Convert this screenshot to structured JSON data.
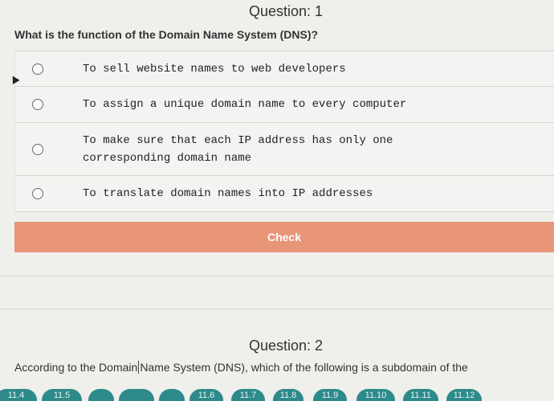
{
  "question1": {
    "header": "Question: 1",
    "prompt": "What is the function of the Domain Name System (DNS)?",
    "choices": [
      {
        "text": "To sell website names to web developers"
      },
      {
        "text": "To assign a unique domain name to every computer"
      },
      {
        "line1": "To make sure that each IP address has only one",
        "line2": "corresponding domain name"
      },
      {
        "text": "To translate domain names into IP addresses"
      }
    ],
    "check_label": "Check"
  },
  "question2": {
    "header": "Question: 2",
    "prompt_before": "According to the Domain",
    "prompt_after": "Name System (DNS), which of the following is a subdomain of the"
  },
  "nav_bubbles": [
    "11.4",
    "11.5",
    "11.6",
    "11.7",
    "11.8",
    "11.9",
    "11.10",
    "11.11",
    "11.12"
  ],
  "colors": {
    "check_button": "#e89578",
    "nav_bubble": "#2d8a8a",
    "background": "#efefec"
  }
}
